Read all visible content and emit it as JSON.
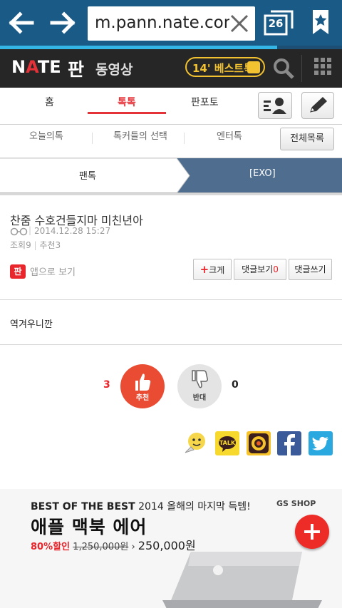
{
  "browser": {
    "url": "m.pann.nate.com",
    "tab_count": "26",
    "page_load_progress": 0.81
  },
  "header": {
    "logo_nate": "NATE",
    "logo_pan": "판",
    "video_link": "동영상",
    "best_badge": "14' 베스트톡"
  },
  "tabs": [
    {
      "label": "홈"
    },
    {
      "label": "톡톡"
    },
    {
      "label": "판포토"
    }
  ],
  "subtabs": [
    {
      "label": "오늘의톡"
    },
    {
      "label": "톡커들의 선택"
    },
    {
      "label": "엔터톡"
    }
  ],
  "all_list_label": "전체목록",
  "breadcrumb": {
    "category": "팬톡",
    "subcategory": "[EXO]"
  },
  "article": {
    "title": "찬줌 수호건들지마 미친년아",
    "author_icon": "glasses-icon",
    "date": "2014.12.28 15:27",
    "views": "조회9",
    "recommends": "추천3",
    "app_icon_label": "판",
    "app_view": "앱으로 보기",
    "body": "역겨우니깐"
  },
  "controls": {
    "bigger_plus": "+",
    "bigger": "크게",
    "view_comments": "댓글보기",
    "comment_count": "0",
    "write_comment": "댓글쓰기"
  },
  "votes": {
    "up_count": "3",
    "up_label": "추천",
    "down_label": "반대",
    "down_count": "0"
  },
  "share": [
    "emoticon-icon",
    "kakaotalk-icon",
    "kakaostory-icon",
    "facebook-icon",
    "twitter-icon"
  ],
  "share_talk": "TALK",
  "ad": {
    "headline_bold": "BEST OF THE BEST",
    "headline_rest": "2014 올해의 마지막 득템!",
    "brand": "GS SHOP",
    "product": "애플 맥북 에어",
    "discount": "80%할인",
    "original_price": "1,250,000원",
    "arrow": "›",
    "final_price": "250,000원"
  },
  "colors": {
    "browser_bar": "#1a5a86",
    "accent_red": "#e53238",
    "header_bg": "#262626",
    "badge_yellow": "#f2c230",
    "progress": "#33b5e5"
  }
}
